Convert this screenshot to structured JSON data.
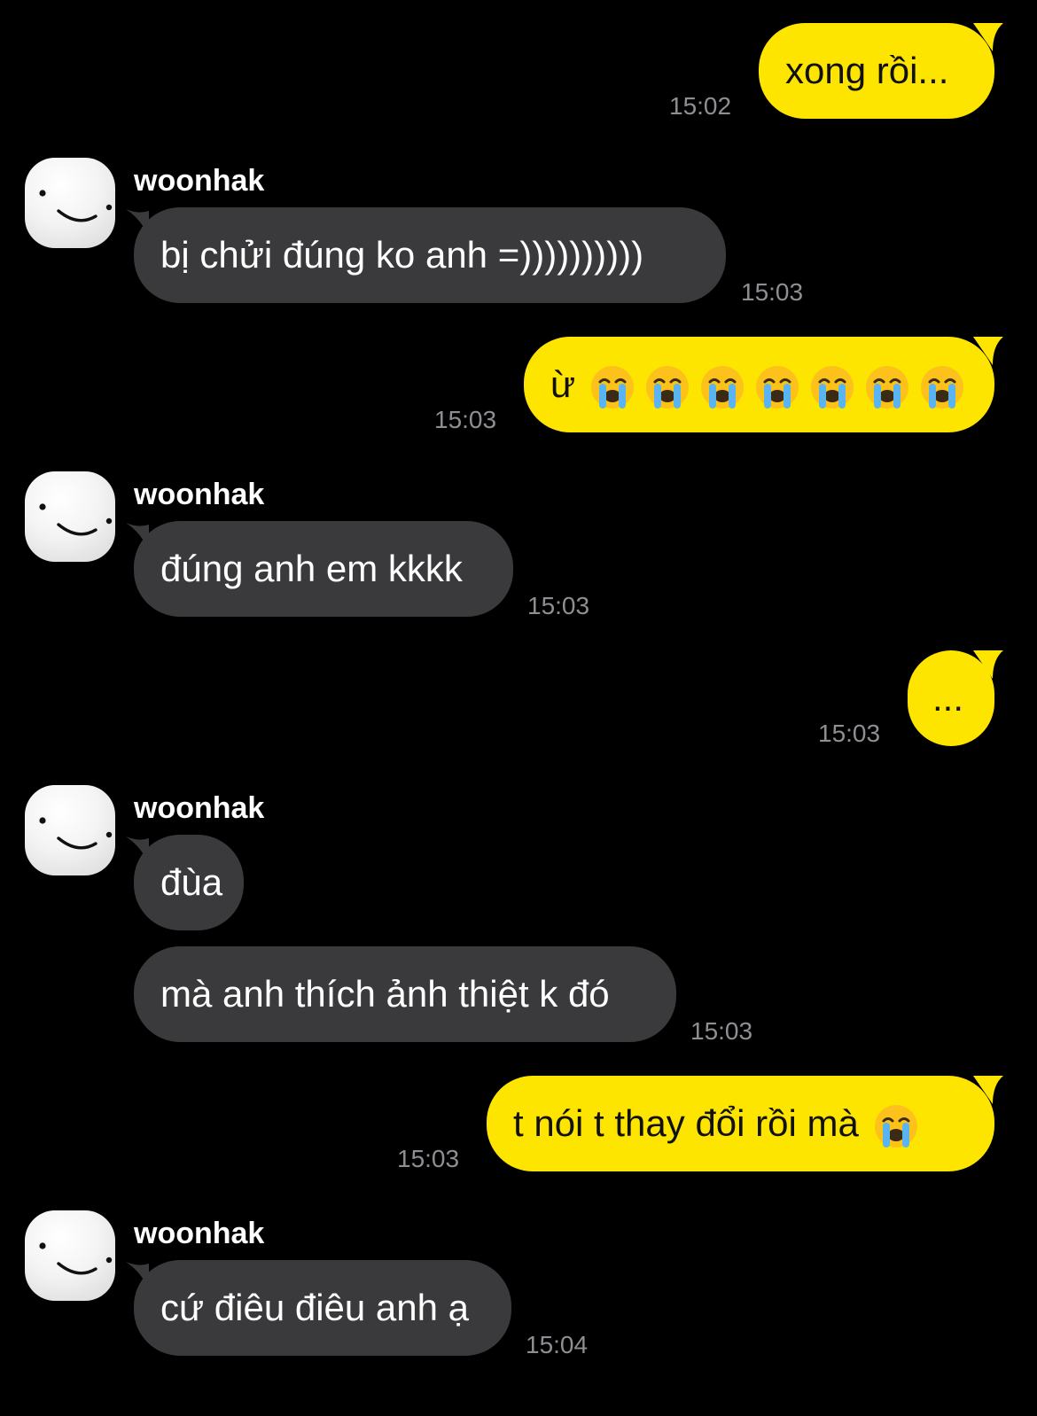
{
  "colors": {
    "background": "#000000",
    "outgoing_bubble": "#fee500",
    "incoming_bubble": "#3a3a3c",
    "timestamp": "#8e8e93"
  },
  "contact": {
    "name": "woonhak",
    "avatar_icon": "white-blob-face-avatar-icon"
  },
  "messages": [
    {
      "direction": "out",
      "text": "xong rồi...",
      "time": "15:02"
    },
    {
      "direction": "in",
      "sender": "woonhak",
      "text": "bị chửi đúng ko anh =))))))))))",
      "time": "15:03"
    },
    {
      "direction": "out",
      "text": "ừ",
      "emoji": "loudly-crying-face-icon",
      "emoji_count": 7,
      "time": "15:03"
    },
    {
      "direction": "in",
      "sender": "woonhak",
      "text": "đúng anh em kkkk",
      "time": "15:03"
    },
    {
      "direction": "out",
      "text": "...",
      "time": "15:03"
    },
    {
      "direction": "in",
      "sender": "woonhak",
      "text": "đùa"
    },
    {
      "direction": "in",
      "text": "mà anh thích ảnh thiệt k đó",
      "time": "15:03"
    },
    {
      "direction": "out",
      "text": "t nói t thay đổi rồi mà",
      "emoji": "loudly-crying-face-icon",
      "emoji_count": 1,
      "time": "15:03"
    },
    {
      "direction": "in",
      "sender": "woonhak",
      "text": "cứ điêu điêu anh ạ",
      "time": "15:04"
    }
  ]
}
